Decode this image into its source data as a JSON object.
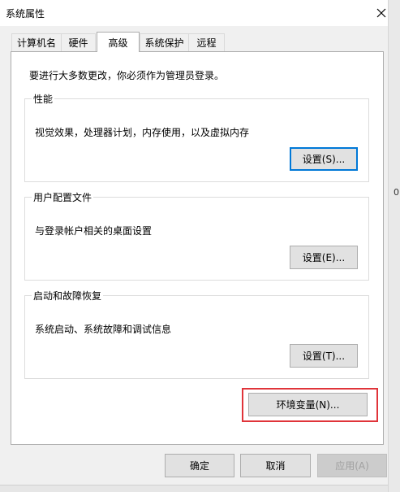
{
  "window": {
    "title": "系统属性"
  },
  "tabs": [
    {
      "label": "计算机名",
      "active": false
    },
    {
      "label": "硬件",
      "active": false
    },
    {
      "label": "高级",
      "active": true
    },
    {
      "label": "系统保护",
      "active": false
    },
    {
      "label": "远程",
      "active": false
    }
  ],
  "advanced": {
    "admin_notice": "要进行大多数更改，你必须作为管理员登录。",
    "performance": {
      "title": "性能",
      "description": "视觉效果，处理器计划，内存使用，以及虚拟内存",
      "button": "设置(S)..."
    },
    "user_profiles": {
      "title": "用户配置文件",
      "description": "与登录帐户相关的桌面设置",
      "button": "设置(E)..."
    },
    "startup_recovery": {
      "title": "启动和故障恢复",
      "description": "系统启动、系统故障和调试信息",
      "button": "设置(T)..."
    },
    "env_button": "环境变量(N)..."
  },
  "footer": {
    "ok": "确定",
    "cancel": "取消",
    "apply": "应用(A)"
  },
  "background": {
    "partial_char": "0"
  },
  "colors": {
    "accent_focus": "#0078d7",
    "highlight_box": "#e0343a"
  }
}
